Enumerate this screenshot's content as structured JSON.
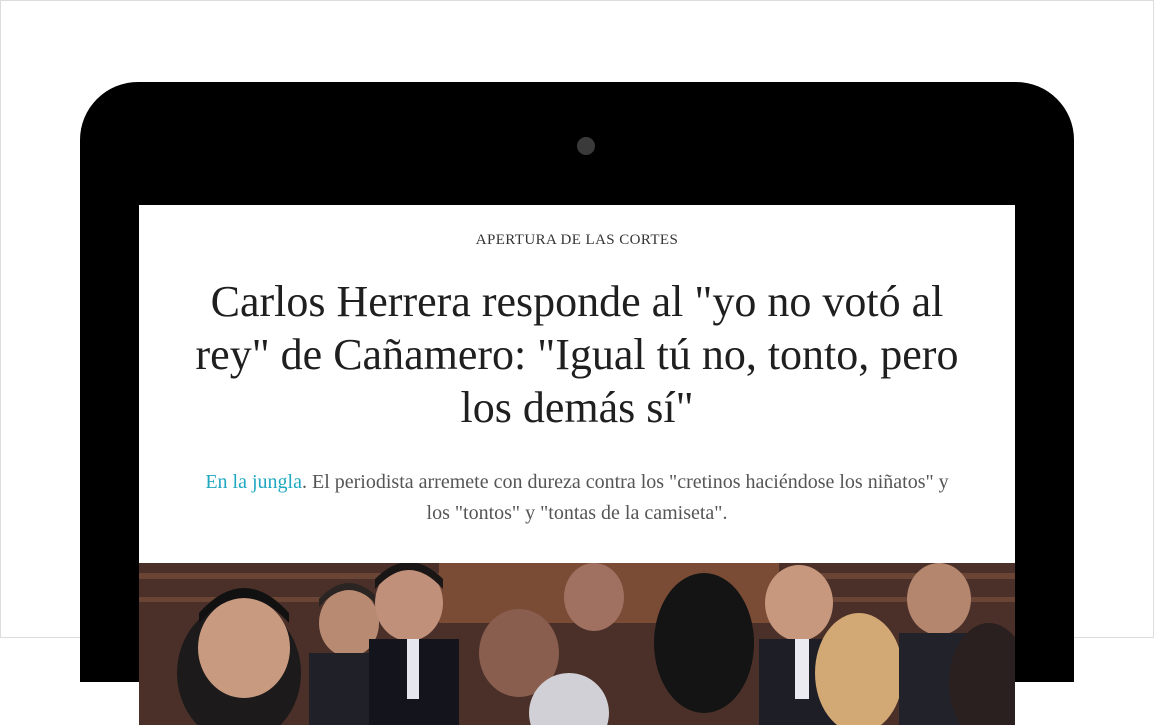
{
  "article": {
    "kicker": "APERTURA DE LAS CORTES",
    "headline": "Carlos Herrera responde al \"yo no votó al rey\" de Cañamero: \"Igual tú no, tonto, pero los demás sí\"",
    "section_link": "En la jungla",
    "subtitle_text": ". El periodista arremete con dureza contra los \"cretinos haciéndose los niñatos\" y los \"tontos\" y \"tontas de la camiseta\"."
  },
  "colors": {
    "link": "#20a8c0",
    "device": "#000000"
  }
}
